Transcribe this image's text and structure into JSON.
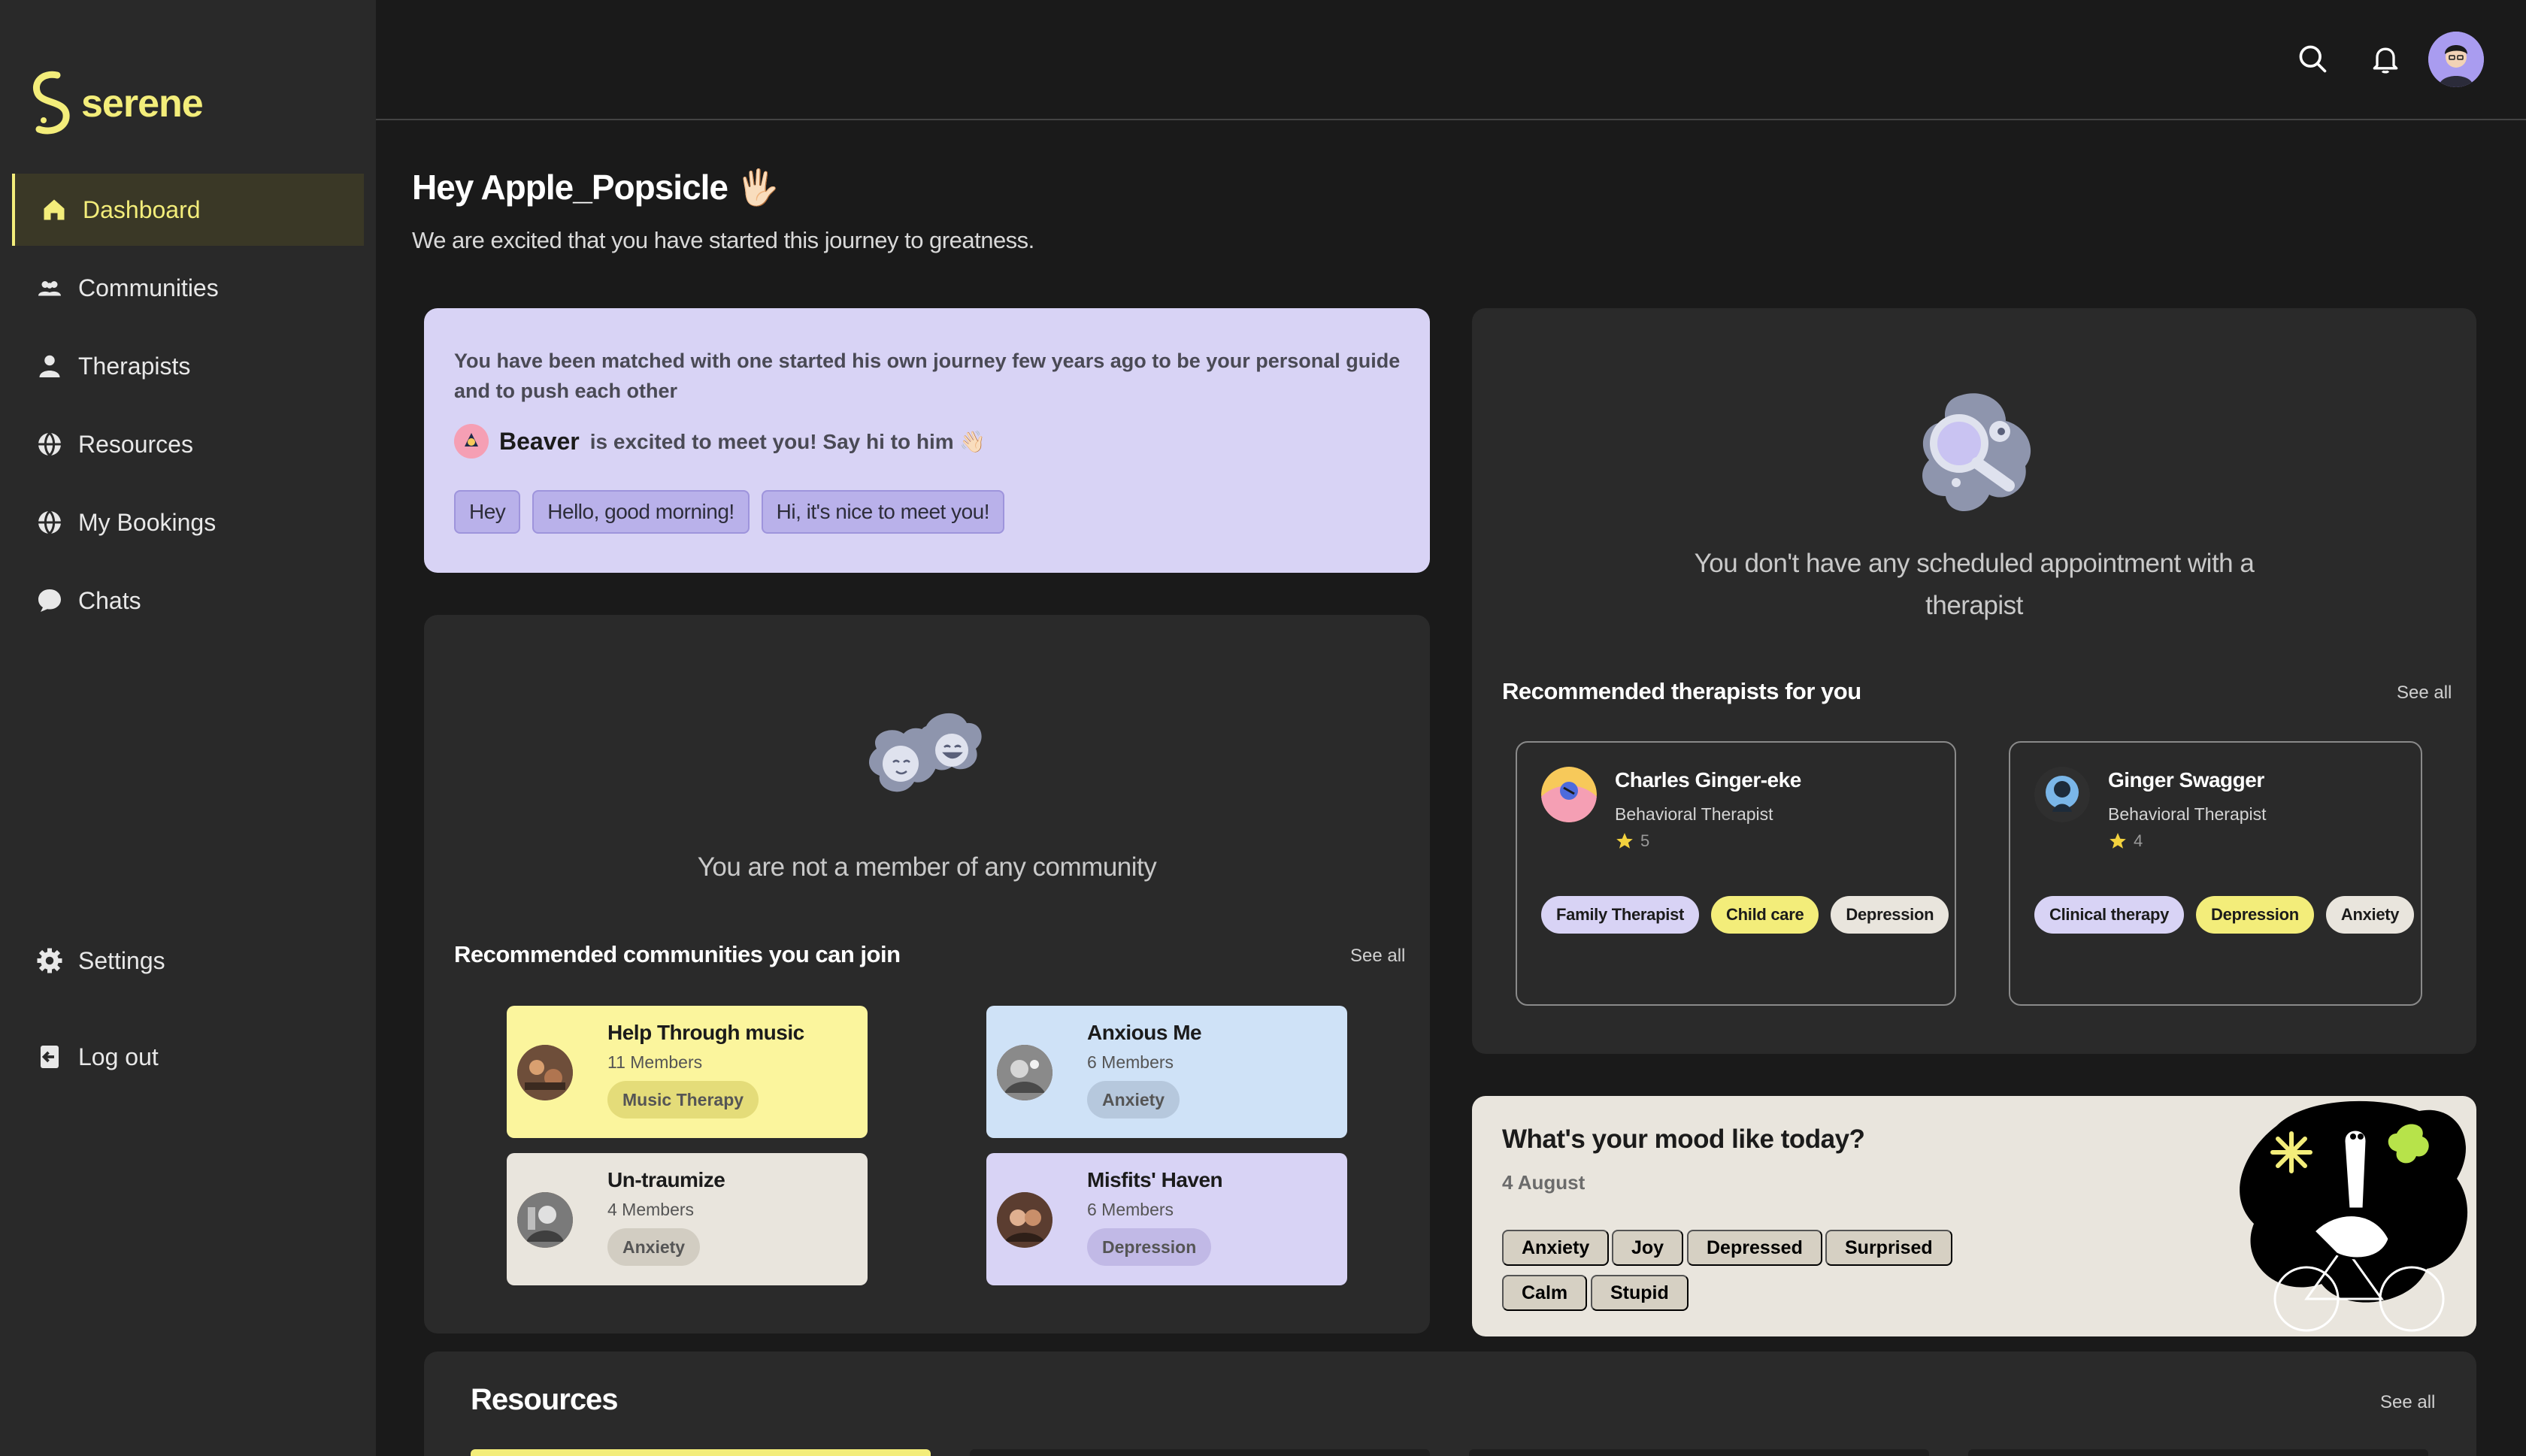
{
  "app": {
    "name": "serene"
  },
  "sidebar": {
    "items": [
      {
        "label": "Dashboard",
        "icon": "home-icon",
        "active": true
      },
      {
        "label": "Communities",
        "icon": "users-icon"
      },
      {
        "label": "Therapists",
        "icon": "person-icon"
      },
      {
        "label": "Resources",
        "icon": "globe-icon"
      },
      {
        "label": "My Bookings",
        "icon": "globe-icon"
      },
      {
        "label": "Chats",
        "icon": "chat-icon"
      }
    ],
    "bottom": [
      {
        "label": "Settings",
        "icon": "gear-icon"
      },
      {
        "label": "Log out",
        "icon": "logout-icon"
      }
    ]
  },
  "header": {
    "icons": [
      "search-icon",
      "bell-icon",
      "avatar"
    ]
  },
  "greeting": {
    "title": "Hey Apple_Popsicle 🖐🏻",
    "subtitle": "We are excited that you have started this journey to greatness."
  },
  "match": {
    "text": "You have been matched with one started his own journey few years ago to be your personal guide and to push each other",
    "buddy_name": "Beaver",
    "buddy_message": "is excited to meet you! Say hi to him 👋🏻",
    "replies": [
      "Hey",
      "Hello, good morning!",
      "Hi, it's nice to meet you!"
    ]
  },
  "communities": {
    "empty_text": "You are not a member of any community",
    "recommended_title": "Recommended communities you can join",
    "see_all": "See all",
    "cards": [
      {
        "name": "Help Through music",
        "members": "11 Members",
        "tag": "Music Therapy",
        "bg": "#fbf59d",
        "tag_bg": "#e4dc79"
      },
      {
        "name": "Anxious Me",
        "members": "6 Members",
        "tag": "Anxiety",
        "bg": "#cfe2f7",
        "tag_bg": "#b6c8dd"
      },
      {
        "name": "Un-traumize",
        "members": "4 Members",
        "tag": "Anxiety",
        "bg": "#e9e5dd",
        "tag_bg": "#d2cdc2"
      },
      {
        "name": "Misfits' Haven",
        "members": "6 Members",
        "tag": "Depression",
        "bg": "#d8d3f5",
        "tag_bg": "#c1b9e6"
      }
    ]
  },
  "appointments": {
    "empty_text": "You don't have any scheduled appointment with a therapist",
    "recommended_title": "Recommended therapists for you",
    "see_all": "See all",
    "therapists": [
      {
        "name": "Charles Ginger-eke",
        "role": "Behavioral Therapist",
        "rating": "5",
        "tags": [
          {
            "label": "Family Therapist",
            "bg": "#d8d3f5"
          },
          {
            "label": "Child care",
            "bg": "#f3ed7a"
          },
          {
            "label": "Depression",
            "bg": "#e9e5dd"
          }
        ]
      },
      {
        "name": "Ginger Swagger",
        "role": "Behavioral Therapist",
        "rating": "4",
        "tags": [
          {
            "label": "Clinical therapy",
            "bg": "#d8d3f5"
          },
          {
            "label": "Depression",
            "bg": "#f3ed7a"
          },
          {
            "label": "Anxiety",
            "bg": "#e9e5dd"
          }
        ]
      }
    ]
  },
  "mood": {
    "title": "What's your mood like today?",
    "date": "4 August",
    "options": [
      "Anxiety",
      "Joy",
      "Depressed",
      "Surprised",
      "Calm",
      "Stupid"
    ]
  },
  "resources": {
    "title": "Resources",
    "see_all": "See all"
  },
  "colors": {
    "accent": "#f3ed7a",
    "lavender": "#d8d3f5",
    "panel": "#2a2a2a",
    "sidebar": "#292929"
  }
}
